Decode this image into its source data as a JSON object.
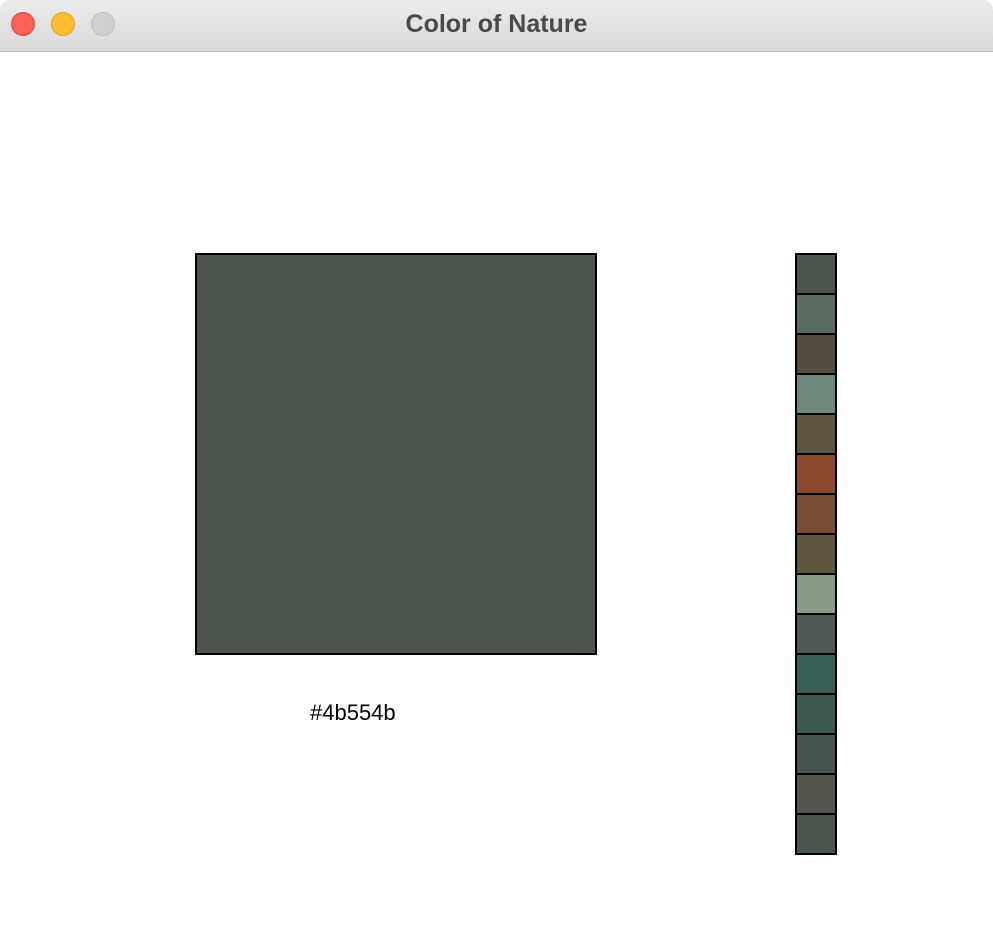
{
  "window": {
    "title": "Color of Nature"
  },
  "selected": {
    "hex": "#4b554b",
    "color": "#4b554b"
  },
  "palette": [
    {
      "color": "#4b554b"
    },
    {
      "color": "#5b6b60"
    },
    {
      "color": "#564d42"
    },
    {
      "color": "#6b8a7a"
    },
    {
      "color": "#5e5542"
    },
    {
      "color": "#8b4a2f"
    },
    {
      "color": "#774d34"
    },
    {
      "color": "#5e563d"
    },
    {
      "color": "#8a9a88"
    },
    {
      "color": "#4f5a55"
    },
    {
      "color": "#3b5f56"
    },
    {
      "color": "#3c5a52"
    },
    {
      "color": "#48554f"
    },
    {
      "color": "#55554c"
    },
    {
      "color": "#4a554d"
    }
  ]
}
